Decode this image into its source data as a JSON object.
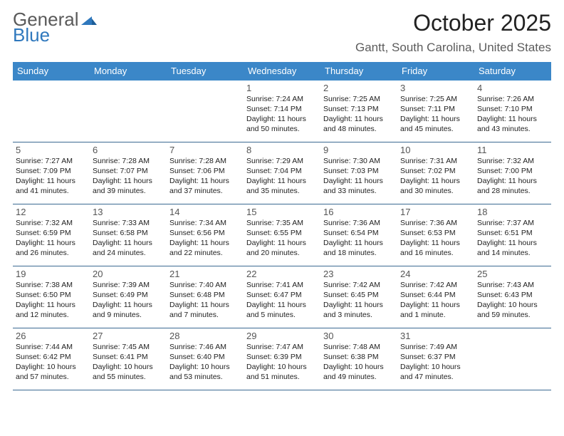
{
  "brand": {
    "word1": "General",
    "word2": "Blue"
  },
  "title": "October 2025",
  "location": "Gantt, South Carolina, United States",
  "weekdays": [
    "Sunday",
    "Monday",
    "Tuesday",
    "Wednesday",
    "Thursday",
    "Friday",
    "Saturday"
  ],
  "weeks": [
    [
      null,
      null,
      null,
      {
        "n": "1",
        "sr": "Sunrise: 7:24 AM",
        "ss": "Sunset: 7:14 PM",
        "dl": "Daylight: 11 hours and 50 minutes."
      },
      {
        "n": "2",
        "sr": "Sunrise: 7:25 AM",
        "ss": "Sunset: 7:13 PM",
        "dl": "Daylight: 11 hours and 48 minutes."
      },
      {
        "n": "3",
        "sr": "Sunrise: 7:25 AM",
        "ss": "Sunset: 7:11 PM",
        "dl": "Daylight: 11 hours and 45 minutes."
      },
      {
        "n": "4",
        "sr": "Sunrise: 7:26 AM",
        "ss": "Sunset: 7:10 PM",
        "dl": "Daylight: 11 hours and 43 minutes."
      }
    ],
    [
      {
        "n": "5",
        "sr": "Sunrise: 7:27 AM",
        "ss": "Sunset: 7:09 PM",
        "dl": "Daylight: 11 hours and 41 minutes."
      },
      {
        "n": "6",
        "sr": "Sunrise: 7:28 AM",
        "ss": "Sunset: 7:07 PM",
        "dl": "Daylight: 11 hours and 39 minutes."
      },
      {
        "n": "7",
        "sr": "Sunrise: 7:28 AM",
        "ss": "Sunset: 7:06 PM",
        "dl": "Daylight: 11 hours and 37 minutes."
      },
      {
        "n": "8",
        "sr": "Sunrise: 7:29 AM",
        "ss": "Sunset: 7:04 PM",
        "dl": "Daylight: 11 hours and 35 minutes."
      },
      {
        "n": "9",
        "sr": "Sunrise: 7:30 AM",
        "ss": "Sunset: 7:03 PM",
        "dl": "Daylight: 11 hours and 33 minutes."
      },
      {
        "n": "10",
        "sr": "Sunrise: 7:31 AM",
        "ss": "Sunset: 7:02 PM",
        "dl": "Daylight: 11 hours and 30 minutes."
      },
      {
        "n": "11",
        "sr": "Sunrise: 7:32 AM",
        "ss": "Sunset: 7:00 PM",
        "dl": "Daylight: 11 hours and 28 minutes."
      }
    ],
    [
      {
        "n": "12",
        "sr": "Sunrise: 7:32 AM",
        "ss": "Sunset: 6:59 PM",
        "dl": "Daylight: 11 hours and 26 minutes."
      },
      {
        "n": "13",
        "sr": "Sunrise: 7:33 AM",
        "ss": "Sunset: 6:58 PM",
        "dl": "Daylight: 11 hours and 24 minutes."
      },
      {
        "n": "14",
        "sr": "Sunrise: 7:34 AM",
        "ss": "Sunset: 6:56 PM",
        "dl": "Daylight: 11 hours and 22 minutes."
      },
      {
        "n": "15",
        "sr": "Sunrise: 7:35 AM",
        "ss": "Sunset: 6:55 PM",
        "dl": "Daylight: 11 hours and 20 minutes."
      },
      {
        "n": "16",
        "sr": "Sunrise: 7:36 AM",
        "ss": "Sunset: 6:54 PM",
        "dl": "Daylight: 11 hours and 18 minutes."
      },
      {
        "n": "17",
        "sr": "Sunrise: 7:36 AM",
        "ss": "Sunset: 6:53 PM",
        "dl": "Daylight: 11 hours and 16 minutes."
      },
      {
        "n": "18",
        "sr": "Sunrise: 7:37 AM",
        "ss": "Sunset: 6:51 PM",
        "dl": "Daylight: 11 hours and 14 minutes."
      }
    ],
    [
      {
        "n": "19",
        "sr": "Sunrise: 7:38 AM",
        "ss": "Sunset: 6:50 PM",
        "dl": "Daylight: 11 hours and 12 minutes."
      },
      {
        "n": "20",
        "sr": "Sunrise: 7:39 AM",
        "ss": "Sunset: 6:49 PM",
        "dl": "Daylight: 11 hours and 9 minutes."
      },
      {
        "n": "21",
        "sr": "Sunrise: 7:40 AM",
        "ss": "Sunset: 6:48 PM",
        "dl": "Daylight: 11 hours and 7 minutes."
      },
      {
        "n": "22",
        "sr": "Sunrise: 7:41 AM",
        "ss": "Sunset: 6:47 PM",
        "dl": "Daylight: 11 hours and 5 minutes."
      },
      {
        "n": "23",
        "sr": "Sunrise: 7:42 AM",
        "ss": "Sunset: 6:45 PM",
        "dl": "Daylight: 11 hours and 3 minutes."
      },
      {
        "n": "24",
        "sr": "Sunrise: 7:42 AM",
        "ss": "Sunset: 6:44 PM",
        "dl": "Daylight: 11 hours and 1 minute."
      },
      {
        "n": "25",
        "sr": "Sunrise: 7:43 AM",
        "ss": "Sunset: 6:43 PM",
        "dl": "Daylight: 10 hours and 59 minutes."
      }
    ],
    [
      {
        "n": "26",
        "sr": "Sunrise: 7:44 AM",
        "ss": "Sunset: 6:42 PM",
        "dl": "Daylight: 10 hours and 57 minutes."
      },
      {
        "n": "27",
        "sr": "Sunrise: 7:45 AM",
        "ss": "Sunset: 6:41 PM",
        "dl": "Daylight: 10 hours and 55 minutes."
      },
      {
        "n": "28",
        "sr": "Sunrise: 7:46 AM",
        "ss": "Sunset: 6:40 PM",
        "dl": "Daylight: 10 hours and 53 minutes."
      },
      {
        "n": "29",
        "sr": "Sunrise: 7:47 AM",
        "ss": "Sunset: 6:39 PM",
        "dl": "Daylight: 10 hours and 51 minutes."
      },
      {
        "n": "30",
        "sr": "Sunrise: 7:48 AM",
        "ss": "Sunset: 6:38 PM",
        "dl": "Daylight: 10 hours and 49 minutes."
      },
      {
        "n": "31",
        "sr": "Sunrise: 7:49 AM",
        "ss": "Sunset: 6:37 PM",
        "dl": "Daylight: 10 hours and 47 minutes."
      },
      null
    ]
  ]
}
